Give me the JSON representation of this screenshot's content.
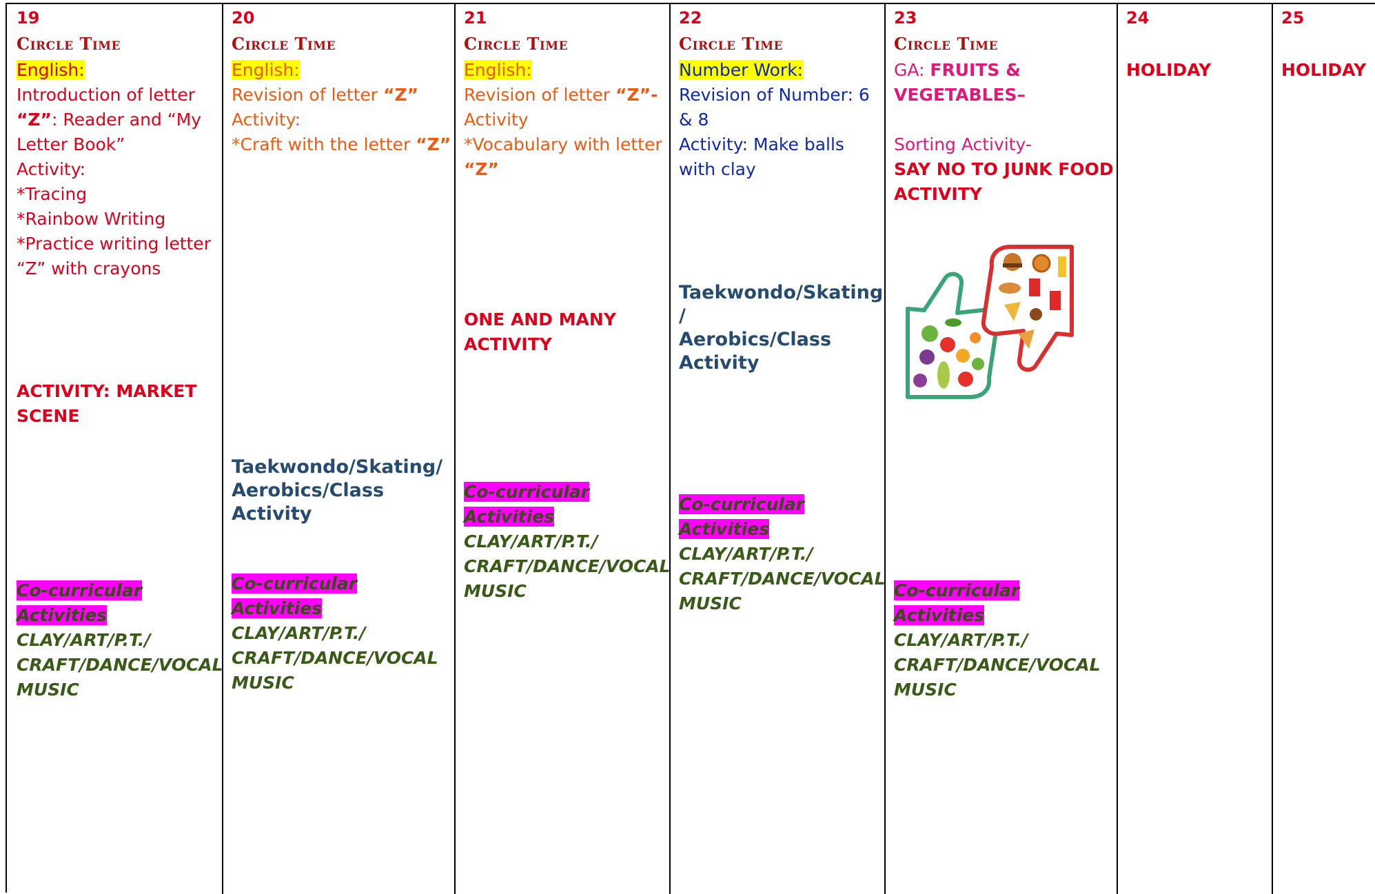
{
  "columns": [
    {
      "date": "19",
      "circle_time": "Circle Time",
      "subject": "English:",
      "lines": [
        "Introduction of letter",
        "“Z”",
        ": Reader and “My",
        "Letter Book”",
        "Activity:",
        "*Tracing",
        "*Rainbow Writing",
        "*Practice writing letter",
        "“Z” with crayons"
      ],
      "activity": [
        "ACTIVITY: MARKET",
        "SCENE"
      ],
      "cocurricular_title": "Co-curricular Activities",
      "cocurricular_lines": [
        "CLAY/ART/P.T./",
        "CRAFT/DANCE/VOCAL",
        "MUSIC"
      ]
    },
    {
      "date": "20",
      "circle_time": "Circle Time",
      "subject": "English:",
      "lines": [
        "Revision of letter ",
        "“Z”",
        "Activity:",
        "*Craft with the letter ",
        "“Z”"
      ],
      "sports": [
        "Taekwondo/Skating/",
        "Aerobics/Class",
        "Activity"
      ],
      "cocurricular_title": "Co-curricular Activities",
      "cocurricular_lines": [
        "CLAY/ART/P.T./",
        "CRAFT/DANCE/VOCAL",
        "MUSIC"
      ]
    },
    {
      "date": "21",
      "circle_time": "Circle Time",
      "subject": "English:",
      "lines": [
        "Revision of letter ",
        "“Z”-",
        "Activity",
        "*Vocabulary with letter",
        "“Z”"
      ],
      "activity": [
        "ONE AND MANY",
        "ACTIVITY"
      ],
      "cocurricular_title": "Co-curricular Activities",
      "cocurricular_lines": [
        "CLAY/ART/P.T./",
        "CRAFT/DANCE/VOCAL",
        "MUSIC"
      ]
    },
    {
      "date": "22",
      "circle_time": "Circle Time",
      "subject": "Number Work:",
      "lines": [
        "Revision of Number: 6",
        "& 8",
        "Activity: Make balls",
        "with clay"
      ],
      "sports": [
        "Taekwondo/Skating",
        "/",
        "Aerobics/Class",
        "Activity"
      ],
      "cocurricular_title": "Co-curricular Activities",
      "cocurricular_lines": [
        "CLAY/ART/P.T./",
        "CRAFT/DANCE/VOCAL",
        "MUSIC"
      ]
    },
    {
      "date": "23",
      "circle_time": "Circle Time",
      "ga_label": "GA: ",
      "ga_topic": [
        "FRUITS &",
        "VEGETABLES–"
      ],
      "sorting": "Sorting Activity-",
      "activity": [
        "SAY NO TO JUNK FOOD",
        "ACTIVITY"
      ],
      "cocurricular_title": "Co-curricular Activities",
      "cocurricular_lines": [
        "CLAY/ART/P.T./",
        "CRAFT/DANCE/VOCAL",
        "MUSIC"
      ]
    },
    {
      "date": "24",
      "label": "HOLIDAY"
    },
    {
      "date": "25",
      "label": "HOLIDAY"
    }
  ],
  "image": {
    "icon": "healthy-vs-junk-food-thumbs-icon"
  }
}
